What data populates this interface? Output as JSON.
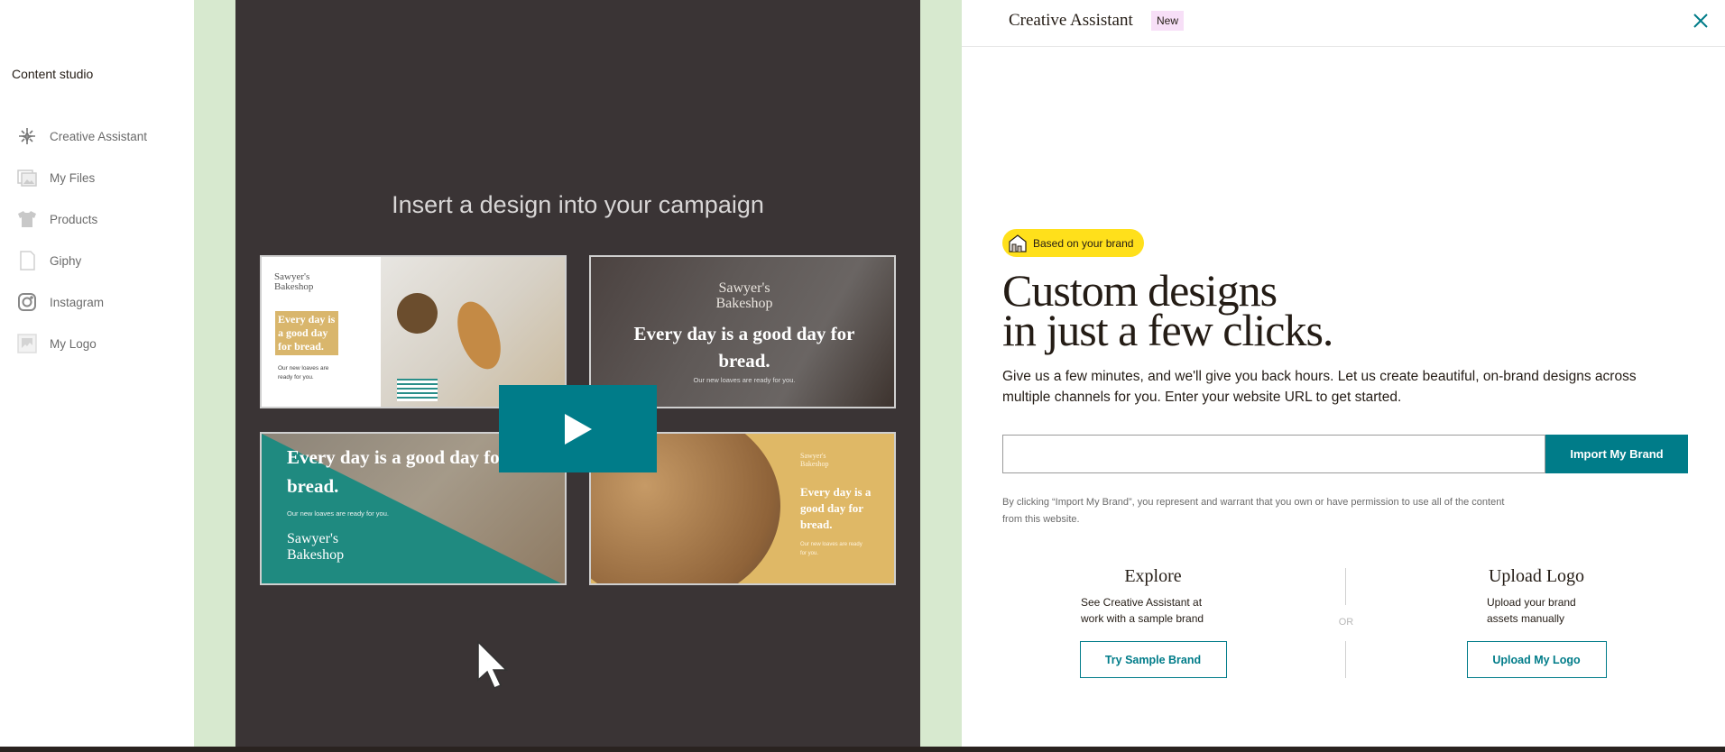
{
  "sidebar": {
    "title": "Content studio",
    "items": [
      {
        "label": "Creative Assistant",
        "icon": "sparkle-icon"
      },
      {
        "label": "My Files",
        "icon": "images-icon"
      },
      {
        "label": "Products",
        "icon": "tshirt-icon"
      },
      {
        "label": "Giphy",
        "icon": "file-icon"
      },
      {
        "label": "Instagram",
        "icon": "instagram-icon"
      },
      {
        "label": "My Logo",
        "icon": "logo-image-icon"
      }
    ]
  },
  "video": {
    "title": "Insert a design into your campaign",
    "cards": [
      {
        "logo": "Sawyer's Bakeshop",
        "tagline": "Every day is a good day for bread.",
        "sub": "Our new loaves are ready for you."
      },
      {
        "logo": "Sawyer's Bakeshop",
        "tagline": "Every day is a good day for bread.",
        "sub": "Our new loaves are ready for you."
      },
      {
        "logo": "Sawyer's Bakeshop",
        "tagline": "Every day is a good day for bread.",
        "sub": "Our new loaves are ready for you."
      },
      {
        "logo": "Sawyer's Bakeshop",
        "tagline": "Every day is a good day for bread.",
        "sub": "Our new loaves are ready for you."
      }
    ],
    "play_icon": "play-icon"
  },
  "panel": {
    "title": "Creative Assistant",
    "badge": "New",
    "brand_badge": "Based on your brand",
    "headline_1": "Custom designs",
    "headline_2": "in just a few clicks.",
    "paragraph": "Give us a few minutes, and we'll give you back hours. Let us create beautiful, on-brand designs across multiple channels for you. Enter your website URL to get started.",
    "url_value": "",
    "import_label": "Import My Brand",
    "disclaimer": "By clicking “Import My Brand”, you represent and warrant that you own or have permission to use all of the content from this website.",
    "or_label": "OR",
    "explore": {
      "title": "Explore",
      "desc": "See Creative Assistant at work with a sample brand",
      "button": "Try Sample Brand"
    },
    "upload": {
      "title": "Upload Logo",
      "desc": "Upload your brand assets manually",
      "button": "Upload My Logo"
    }
  },
  "colors": {
    "accent": "#007c89",
    "yellow": "#ffe01b",
    "green_strip": "#d7e9cf",
    "video_bg": "#3a3435",
    "new_badge": "#f7dff7"
  }
}
